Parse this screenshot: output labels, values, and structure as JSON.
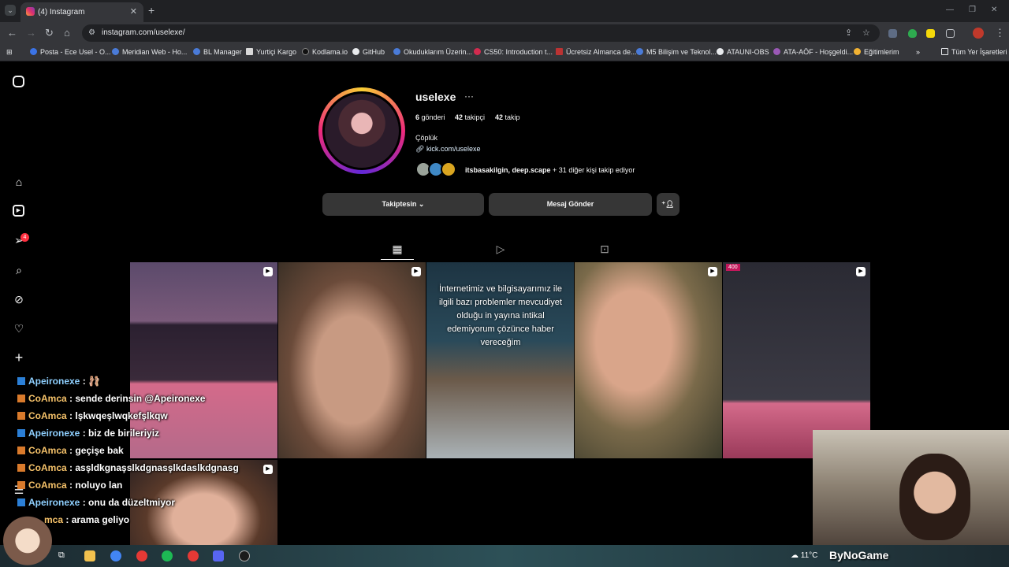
{
  "browser": {
    "tab_title": "(4) Instagram",
    "tab_close": "✕",
    "new_tab": "+",
    "url": "instagram.com/uselexe/",
    "bookmarks": [
      {
        "label": "Posta - Ece Usel - O...",
        "color": "#3b73e6"
      },
      {
        "label": "Meridian Web - Ho...",
        "color": "#4a7bd8"
      },
      {
        "label": "BL Manager",
        "color": "#4a7bd8"
      },
      {
        "label": "Yurtiçi Kargo",
        "color": "#d8d8d8"
      },
      {
        "label": "Kodlama.io",
        "color": "#222222"
      },
      {
        "label": "GitHub",
        "color": "#e8eaed"
      },
      {
        "label": "Okuduklarım Üzerin...",
        "color": "#4a7bd8"
      },
      {
        "label": "CS50: Introduction t...",
        "color": "#d22b4f"
      },
      {
        "label": "Ücretsiz Almanca de...",
        "color": "#b33"
      },
      {
        "label": "M5 Bilişim ve Teknol...",
        "color": "#4a7bd8"
      },
      {
        "label": "ATAUNI-OBS",
        "color": "#e8eaed"
      },
      {
        "label": "ATA-AÖF - Hoşgeldi...",
        "color": "#9b59b6"
      },
      {
        "label": "Eğitimlerim",
        "color": "#f2b233"
      }
    ],
    "all_bookmarks": "Tüm Yer İşaretleri"
  },
  "profile": {
    "username": "uselexe",
    "posts_count": "6",
    "posts_label": "gönderi",
    "followers_count": "42",
    "followers_label": "takipçi",
    "following_count": "42",
    "following_label": "takip",
    "bio": "Çöplük",
    "link": "kick.com/uselexe",
    "followed_by_names": "itsbasakilgin, deep.scape",
    "followed_by_rest": " + 31 diğer kişi takip ediyor",
    "following_button": "Takiptesin ⌄",
    "message_button": "Mesaj Gönder"
  },
  "sidebar": {
    "notifications_badge": "4"
  },
  "posts": [
    {
      "id": 1,
      "reel": true
    },
    {
      "id": 2,
      "reel": true
    },
    {
      "id": 3,
      "reel": false,
      "overlay": "İnternetimiz ve bilgisayarımız ile ilgili bazı problemler mevcudiyet olduğu in yayına intikal edemiyorum çözünce haber vereceğim"
    },
    {
      "id": 4,
      "reel": true
    },
    {
      "id": 5,
      "reel": true,
      "tag": "400"
    },
    {
      "id": 6,
      "reel": true
    }
  ],
  "chat": [
    {
      "user": "Apeironexe",
      "sep": " : ",
      "msg": "🩰",
      "type": "u1"
    },
    {
      "user": "CoAmca",
      "sep": " : ",
      "msg": "sende derinsin @Apeironexe",
      "type": "u2"
    },
    {
      "user": "CoAmca",
      "sep": " : ",
      "msg": "lşkwqeşlwqkefşlkqw",
      "type": "u2"
    },
    {
      "user": "Apeironexe",
      "sep": " : ",
      "msg": "biz de birileriyiz",
      "type": "u1"
    },
    {
      "user": "CoAmca",
      "sep": " : ",
      "msg": "geçişe bak",
      "type": "u2"
    },
    {
      "user": "CoAmca",
      "sep": " : ",
      "msg": "asşldkgnaşslkdgnasşlkdaslkdgnasg",
      "type": "u2"
    },
    {
      "user": "CoAmca",
      "sep": " : ",
      "msg": "noluyo lan",
      "type": "u2"
    },
    {
      "user": "Apeironexe",
      "sep": " : ",
      "msg": "onu da düzeltmiyor",
      "type": "u1"
    },
    {
      "user": "mca",
      "sep": " : ",
      "msg": "arama geliyo",
      "type": "u2"
    }
  ],
  "taskbar": {
    "weather": "11°C"
  },
  "watermark": "ByNoGame"
}
